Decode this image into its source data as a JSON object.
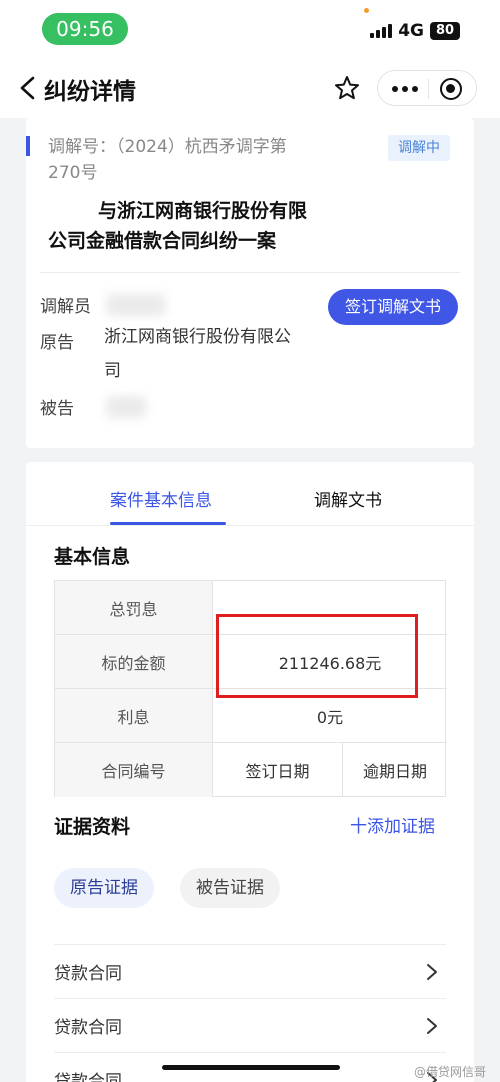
{
  "status_bar": {
    "time": "09:56",
    "network": "4G",
    "battery": "80"
  },
  "nav": {
    "title": "纠纷详情"
  },
  "case": {
    "mediation_no_line1": "调解号：（2024）杭西矛调字第",
    "mediation_no_line2": "270号",
    "status": "调解中",
    "title_line1": "与浙江网商银行股份有限",
    "title_line2": "公司金融借款合同纠纷一案",
    "mediator_label": "调解员",
    "plaintiff_label": "原告",
    "plaintiff_line1": "浙江网商银行股份有限公",
    "plaintiff_line2": "司",
    "defendant_label": "被告",
    "sign_button": "签订调解文书"
  },
  "tabs": [
    {
      "label": "案件基本信息"
    },
    {
      "label": "调解文书"
    }
  ],
  "basic_info": {
    "title": "基本信息",
    "rows": [
      {
        "label": "总罚息",
        "value": ""
      },
      {
        "label": "标的金额",
        "value": "211246.68元"
      },
      {
        "label": "利息",
        "value": "0元"
      }
    ],
    "footer": [
      "合同编号",
      "签订日期",
      "逾期日期"
    ]
  },
  "evidence": {
    "title": "证据资料",
    "add_label": "十添加证据",
    "chips": [
      "原告证据",
      "被告证据"
    ],
    "items": [
      "贷款合同",
      "贷款合同",
      "贷款合同"
    ]
  },
  "watermark": "@借贷网信哥"
}
